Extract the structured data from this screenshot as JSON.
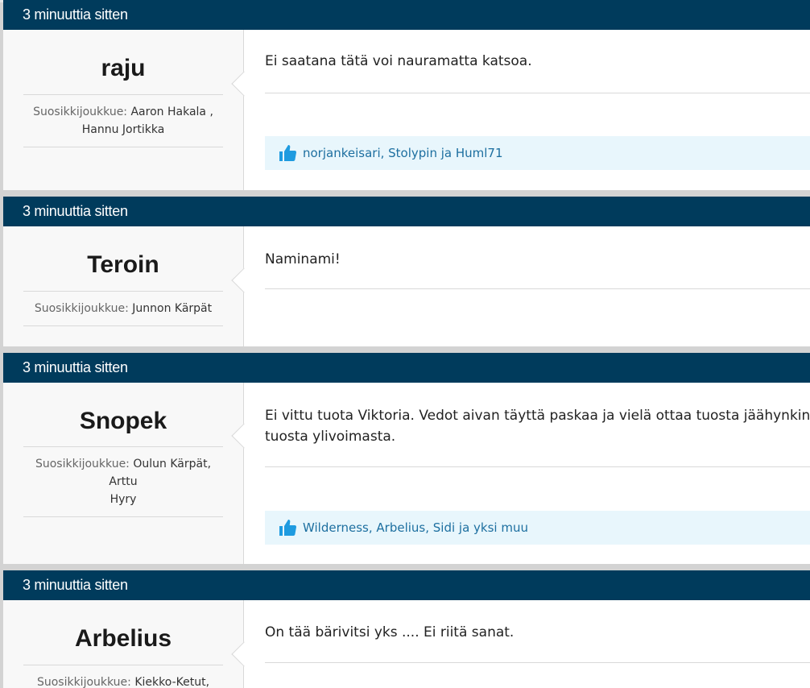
{
  "posts": [
    {
      "timestamp": "3 minuuttia sitten",
      "username": "raju",
      "fav_label": "Suosikkijoukkue:",
      "fav_lines": [
        "Aaron Hakala ,",
        "Hannu Jortikka"
      ],
      "message_lines": [
        "Ei saatana tätä voi nauramatta katsoa."
      ],
      "likes": "norjankeisari, Stolypin ja Huml71"
    },
    {
      "timestamp": "3 minuuttia sitten",
      "username": "Teroin",
      "fav_label": "Suosikkijoukkue:",
      "fav_lines": [
        "Junnon Kärpät"
      ],
      "message_lines": [
        "Naminami!"
      ]
    },
    {
      "timestamp": "3 minuuttia sitten",
      "username": "Snopek",
      "fav_label": "Suosikkijoukkue:",
      "fav_lines": [
        "Oulun Kärpät, Arttu",
        "Hyry"
      ],
      "message_lines": [
        "Ei vittu tuota Viktoria. Vedot aivan täyttä paskaa ja vielä ottaa tuosta jäähynkin. Otta",
        "tuosta ylivoimasta."
      ],
      "likes": "Wilderness, Arbelius, Sidi ja yksi muu"
    },
    {
      "timestamp": "3 minuuttia sitten",
      "username": "Arbelius",
      "fav_label": "Suosikkijoukkue:",
      "fav_lines": [
        "Kiekko-Ketut,"
      ],
      "message_lines": [
        "On tää bärivitsi yks .... Ei riitä sanat."
      ]
    }
  ],
  "colors": {
    "header_bg": "#003b5c",
    "likes_bg": "#e8f6fc",
    "likes_text": "#1d6fa0",
    "thumb": "#1e9be0"
  },
  "icons": {
    "like": "thumbs-up-icon"
  }
}
